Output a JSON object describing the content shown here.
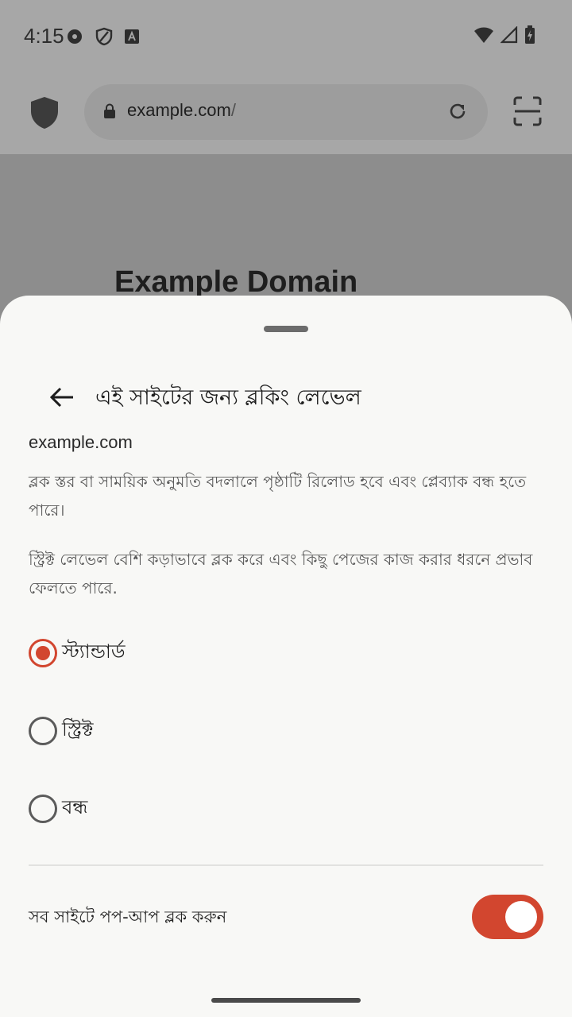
{
  "status": {
    "time": "4:15"
  },
  "browser": {
    "url_host": "example.com",
    "url_path": "/",
    "page_heading": "Example Domain"
  },
  "sheet": {
    "title": "এই সাইটের জন্য ব্লকিং লেভেল",
    "domain": "example.com",
    "description_1": "ব্লক স্তর বা সাময়িক অনুমতি বদলালে পৃষ্ঠাটি রিলোড হবে এবং প্লেব্যাক বন্ধ হতে পারে।",
    "description_2": "স্ট্রিক্ট লেভেল বেশি কড়াভাবে ব্লক করে এবং কিছু পেজের কাজ করার ধরনে প্রভাব ফেলতে পারে.",
    "options": [
      {
        "label": "স্ট্যান্ডার্ড",
        "selected": true
      },
      {
        "label": "স্ট্রিক্ট",
        "selected": false
      },
      {
        "label": "বন্ধ",
        "selected": false
      }
    ],
    "popup_toggle": {
      "label": "সব সাইটে পপ-আপ ব্লক করুন",
      "on": true
    }
  },
  "colors": {
    "accent": "#d2462f"
  }
}
